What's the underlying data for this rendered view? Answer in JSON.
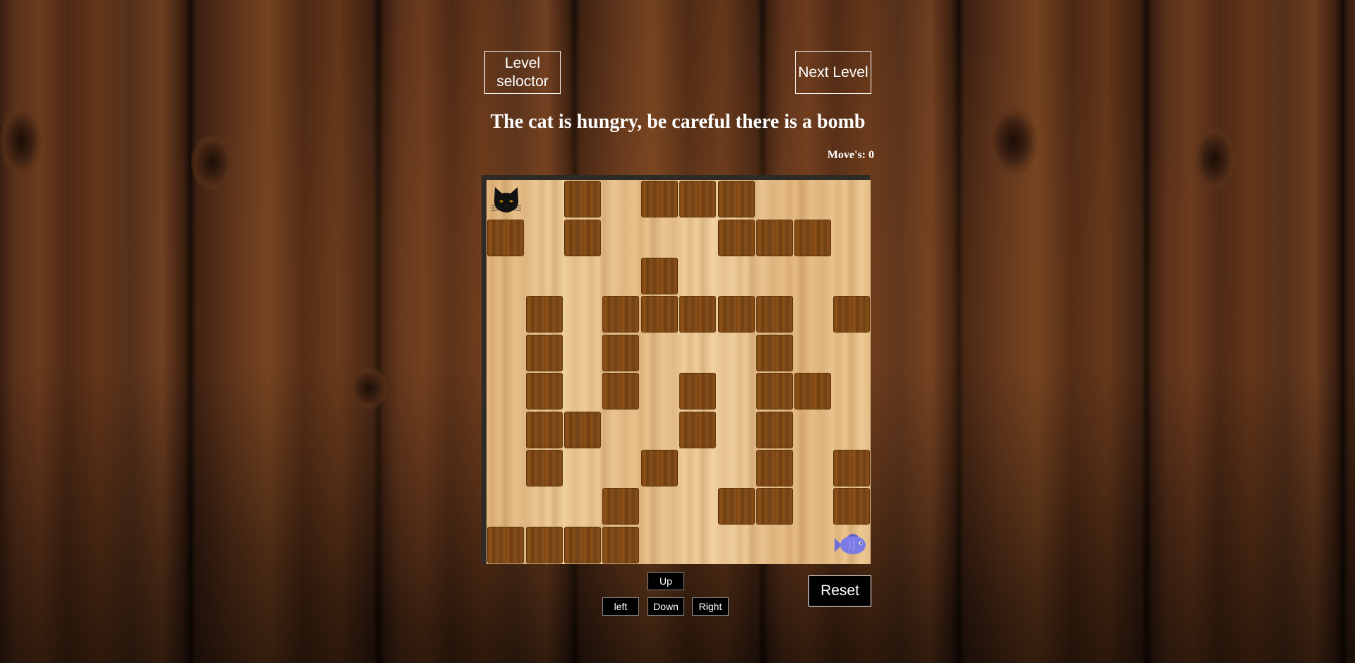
{
  "header": {
    "level_selector_label": "Level seloctor",
    "next_level_label": "Next Level"
  },
  "game": {
    "title": "The cat is hungry, be careful there is a bomb",
    "moves_label": "Move's: 0",
    "moves": 0,
    "grid_size": 10,
    "player": {
      "name": "cat",
      "row": 0,
      "col": 0
    },
    "goal": {
      "name": "fish",
      "row": 9,
      "col": 9
    },
    "walls": [
      [
        0,
        2
      ],
      [
        0,
        4
      ],
      [
        0,
        5
      ],
      [
        0,
        6
      ],
      [
        1,
        0
      ],
      [
        1,
        2
      ],
      [
        1,
        6
      ],
      [
        1,
        7
      ],
      [
        1,
        8
      ],
      [
        2,
        4
      ],
      [
        3,
        1
      ],
      [
        3,
        3
      ],
      [
        3,
        4
      ],
      [
        3,
        5
      ],
      [
        3,
        6
      ],
      [
        3,
        7
      ],
      [
        3,
        9
      ],
      [
        4,
        1
      ],
      [
        4,
        3
      ],
      [
        4,
        7
      ],
      [
        5,
        1
      ],
      [
        5,
        3
      ],
      [
        5,
        5
      ],
      [
        5,
        7
      ],
      [
        5,
        8
      ],
      [
        6,
        1
      ],
      [
        6,
        2
      ],
      [
        6,
        5
      ],
      [
        6,
        7
      ],
      [
        7,
        1
      ],
      [
        7,
        4
      ],
      [
        7,
        7
      ],
      [
        7,
        9
      ],
      [
        8,
        3
      ],
      [
        8,
        6
      ],
      [
        8,
        7
      ],
      [
        8,
        9
      ],
      [
        9,
        0
      ],
      [
        9,
        1
      ],
      [
        9,
        2
      ],
      [
        9,
        3
      ]
    ],
    "colors": {
      "wall": "#7a4412",
      "floor": "#e8c08a",
      "frame": "#2e2a26"
    }
  },
  "controls": {
    "up_label": "Up",
    "left_label": "left",
    "down_label": "Down",
    "right_label": "Right",
    "reset_label": "Reset"
  }
}
